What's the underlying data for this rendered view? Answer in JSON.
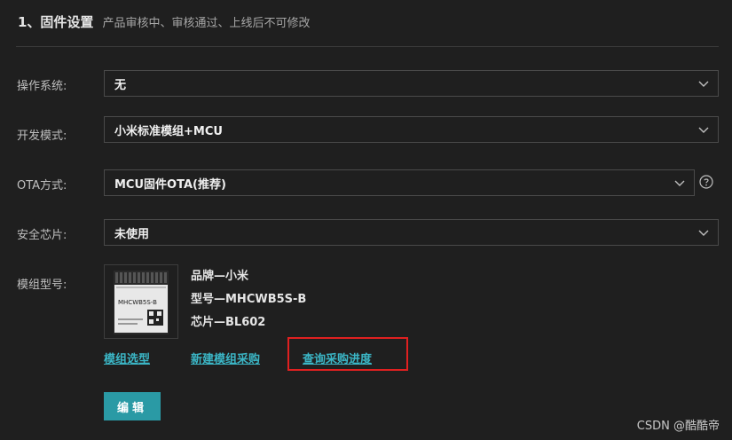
{
  "section": {
    "title": "1、固件设置",
    "subtitle": "产品审核中、审核通过、上线后不可修改"
  },
  "fields": {
    "os": {
      "label": "操作系统:",
      "value": "无"
    },
    "dev_mode": {
      "label": "开发模式:",
      "value": "小米标准模组+MCU"
    },
    "ota": {
      "label": "OTA方式:",
      "value": "MCU固件OTA(推荐)"
    },
    "security_chip": {
      "label": "安全芯片:",
      "value": "未使用"
    },
    "module": {
      "label": "模组型号:",
      "brand": "品牌—小米",
      "model": "型号—MHCWB5S-B",
      "chip": "芯片—BL602",
      "image_text": "MHCWB5S-B"
    }
  },
  "links": {
    "select_module": "模组选型",
    "new_purchase": "新建模组采购",
    "query_purchase": "查询采购进度"
  },
  "buttons": {
    "edit": "编辑"
  },
  "watermark": "CSDN @酷酷帝",
  "colors": {
    "background": "#1f1f1f",
    "link": "#3bb6c6",
    "primary_button": "#2a9aa5",
    "highlight": "#e02020"
  },
  "icons": {
    "select_arrow": "chevron-down-icon",
    "help": "question-circle-icon"
  }
}
